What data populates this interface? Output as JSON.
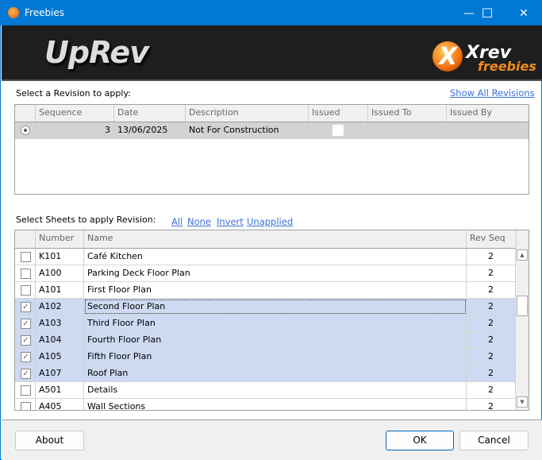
{
  "window": {
    "title": "Freebies",
    "minimize": "—",
    "maximize": "☐",
    "close": "✕"
  },
  "banner": {
    "app_logo": "UpRev",
    "brand_logo_1": "Xrev",
    "brand_logo_2": "freebies"
  },
  "revisions": {
    "label": "Select a Revision to apply:",
    "show_all": "Show All Revisions",
    "columns": [
      "Sequence",
      "Date",
      "Description",
      "Issued",
      "Issued To",
      "Issued By"
    ],
    "rows": [
      {
        "selected": true,
        "sequence": "3",
        "date": "13/06/2025",
        "description": "Not For Construction",
        "issued": false,
        "issued_to": "",
        "issued_by": ""
      }
    ]
  },
  "sheets": {
    "label": "Select Sheets to apply Revision:",
    "links": {
      "all": "All",
      "none": "None",
      "invert": "Invert",
      "unapplied": "Unapplied"
    },
    "columns": [
      "Number",
      "Name",
      "Rev Seq"
    ],
    "rows": [
      {
        "checked": false,
        "number": "K101",
        "name": "Café Kitchen",
        "rev_seq": "2"
      },
      {
        "checked": false,
        "number": "A100",
        "name": "Parking Deck Floor Plan",
        "rev_seq": "2"
      },
      {
        "checked": false,
        "number": "A101",
        "name": "First Floor Plan",
        "rev_seq": "2"
      },
      {
        "checked": true,
        "number": "A102",
        "name": "Second Floor Plan",
        "rev_seq": "2"
      },
      {
        "checked": true,
        "number": "A103",
        "name": "Third Floor Plan",
        "rev_seq": "2"
      },
      {
        "checked": true,
        "number": "A104",
        "name": "Fourth Floor Plan",
        "rev_seq": "2"
      },
      {
        "checked": true,
        "number": "A105",
        "name": "Fifth Floor Plan",
        "rev_seq": "2"
      },
      {
        "checked": true,
        "number": "A107",
        "name": "Roof Plan",
        "rev_seq": "2"
      },
      {
        "checked": false,
        "number": "A501",
        "name": "Details",
        "rev_seq": "2"
      },
      {
        "checked": false,
        "number": "A405",
        "name": "Wall Sections",
        "rev_seq": "2"
      }
    ]
  },
  "buttons": {
    "about": "About",
    "ok": "OK",
    "cancel": "Cancel"
  }
}
